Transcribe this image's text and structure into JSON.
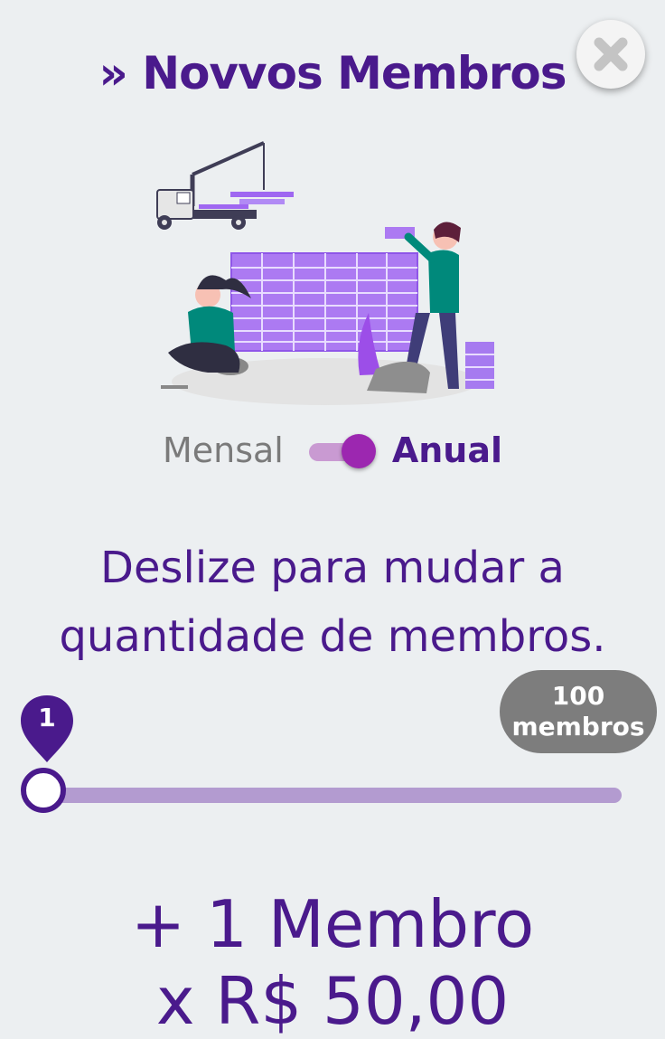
{
  "header": {
    "title": "» Novvos Membros"
  },
  "close_icon": "close-icon",
  "billing": {
    "monthly_label": "Mensal",
    "annual_label": "Anual",
    "selected": "Anual"
  },
  "instruction": "Deslize para mudar a quantidade de membros.",
  "slider": {
    "value": "1",
    "min": 1,
    "max": 100,
    "max_line1": "100",
    "max_line2": "membros"
  },
  "summary": {
    "added_members": "+ 1 Membro",
    "price": "x R$ 50,00"
  },
  "colors": {
    "primary": "#4a1a8c",
    "accent": "#9c27b0",
    "track": "#b39bd0",
    "background": "#eceff1",
    "badge": "#7d7d7d"
  }
}
